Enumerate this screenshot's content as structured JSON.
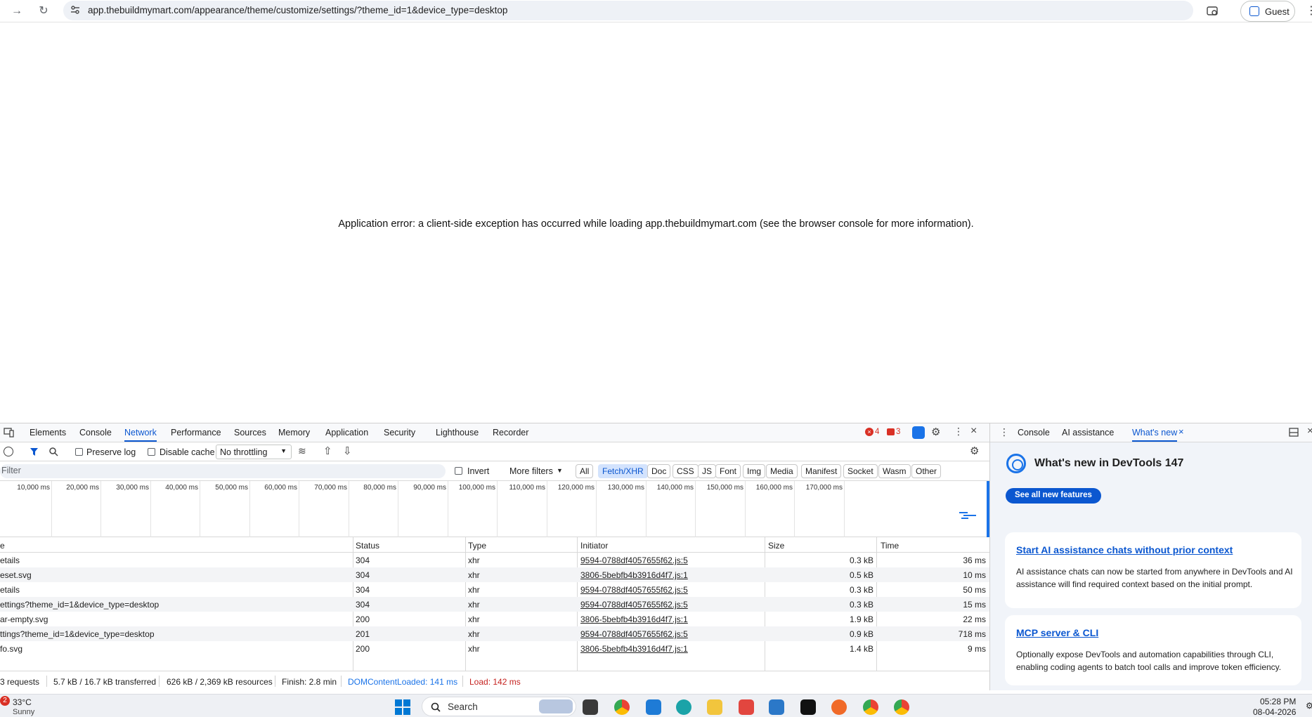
{
  "browser": {
    "url": "app.thebuildmymart.com/appearance/theme/customize/settings/?theme_id=1&device_type=desktop",
    "profile_label": "Guest"
  },
  "page": {
    "error_message": "Application error: a client-side exception has occurred while loading app.thebuildmymart.com (see the browser console for more information)."
  },
  "devtools": {
    "tabs": [
      "Elements",
      "Console",
      "Network",
      "Performance",
      "Sources",
      "Memory",
      "Application",
      "Security",
      "Lighthouse",
      "Recorder"
    ],
    "active_tab": "Network",
    "error_count": "4",
    "issue_count": "3",
    "toolbar": {
      "preserve_log": "Preserve log",
      "disable_cache": "Disable cache",
      "throttling": "No throttling"
    },
    "filter": {
      "placeholder": "Filter",
      "invert": "Invert",
      "more_filters": "More filters",
      "chips": [
        "All",
        "Fetch/XHR",
        "Doc",
        "CSS",
        "JS",
        "Font",
        "Img",
        "Media",
        "Manifest",
        "Socket",
        "Wasm",
        "Other"
      ],
      "selected_chip": "Fetch/XHR"
    },
    "timeline_labels": [
      "10,000 ms",
      "20,000 ms",
      "30,000 ms",
      "40,000 ms",
      "50,000 ms",
      "60,000 ms",
      "70,000 ms",
      "80,000 ms",
      "90,000 ms",
      "100,000 ms",
      "110,000 ms",
      "120,000 ms",
      "130,000 ms",
      "140,000 ms",
      "150,000 ms",
      "160,000 ms",
      "170,000 ms"
    ],
    "columns": [
      "e",
      "Status",
      "Type",
      "Initiator",
      "Size",
      "Time"
    ],
    "rows": [
      {
        "name": "etails",
        "status": "304",
        "type": "xhr",
        "initiator": "9594-0788df4057655f62.js:5",
        "size": "0.3 kB",
        "time": "36 ms"
      },
      {
        "name": "eset.svg",
        "status": "304",
        "type": "xhr",
        "initiator": "3806-5bebfb4b3916d4f7.js:1",
        "size": "0.5 kB",
        "time": "10 ms"
      },
      {
        "name": "etails",
        "status": "304",
        "type": "xhr",
        "initiator": "9594-0788df4057655f62.js:5",
        "size": "0.3 kB",
        "time": "50 ms"
      },
      {
        "name": "ettings?theme_id=1&device_type=desktop",
        "status": "304",
        "type": "xhr",
        "initiator": "9594-0788df4057655f62.js:5",
        "size": "0.3 kB",
        "time": "15 ms"
      },
      {
        "name": "ar-empty.svg",
        "status": "200",
        "type": "xhr",
        "initiator": "3806-5bebfb4b3916d4f7.js:1",
        "size": "1.9 kB",
        "time": "22 ms"
      },
      {
        "name": "ttings?theme_id=1&device_type=desktop",
        "status": "201",
        "type": "xhr",
        "initiator": "9594-0788df4057655f62.js:5",
        "size": "0.9 kB",
        "time": "718 ms"
      },
      {
        "name": "fo.svg",
        "status": "200",
        "type": "xhr",
        "initiator": "3806-5bebfb4b3916d4f7.js:1",
        "size": "1.4 kB",
        "time": "9 ms"
      }
    ],
    "summary": {
      "requests": "3 requests",
      "transferred": "5.7 kB / 16.7 kB transferred",
      "resources": "626 kB / 2,369 kB resources",
      "finish": "Finish: 2.8 min",
      "domcontentloaded": "DOMContentLoaded: 141 ms",
      "load": "Load: 142 ms"
    }
  },
  "drawer": {
    "tabs": [
      "Console",
      "AI assistance",
      "What's new"
    ],
    "active_tab": "What's new",
    "title": "What's new in DevTools 147",
    "see_all": "See all new features",
    "cards": [
      {
        "title": "Start AI assistance chats without prior context",
        "body": "AI assistance chats can now be started from anywhere in DevTools and AI assistance will find required context based on the initial prompt."
      },
      {
        "title": "MCP server & CLI",
        "body": "Optionally expose DevTools and automation capabilities through CLI, enabling coding agents to batch tool calls and improve token efficiency."
      }
    ]
  },
  "taskbar": {
    "weather_badge": "2",
    "temperature": "33°C",
    "condition": "Sunny",
    "search_label": "Search",
    "time": "05:28 PM",
    "date": "08-04-2026"
  },
  "colors": {
    "accent": "#0b57d0",
    "error": "#d93025",
    "dcl_blue": "#1a73e8",
    "load_red": "#c5221f"
  }
}
